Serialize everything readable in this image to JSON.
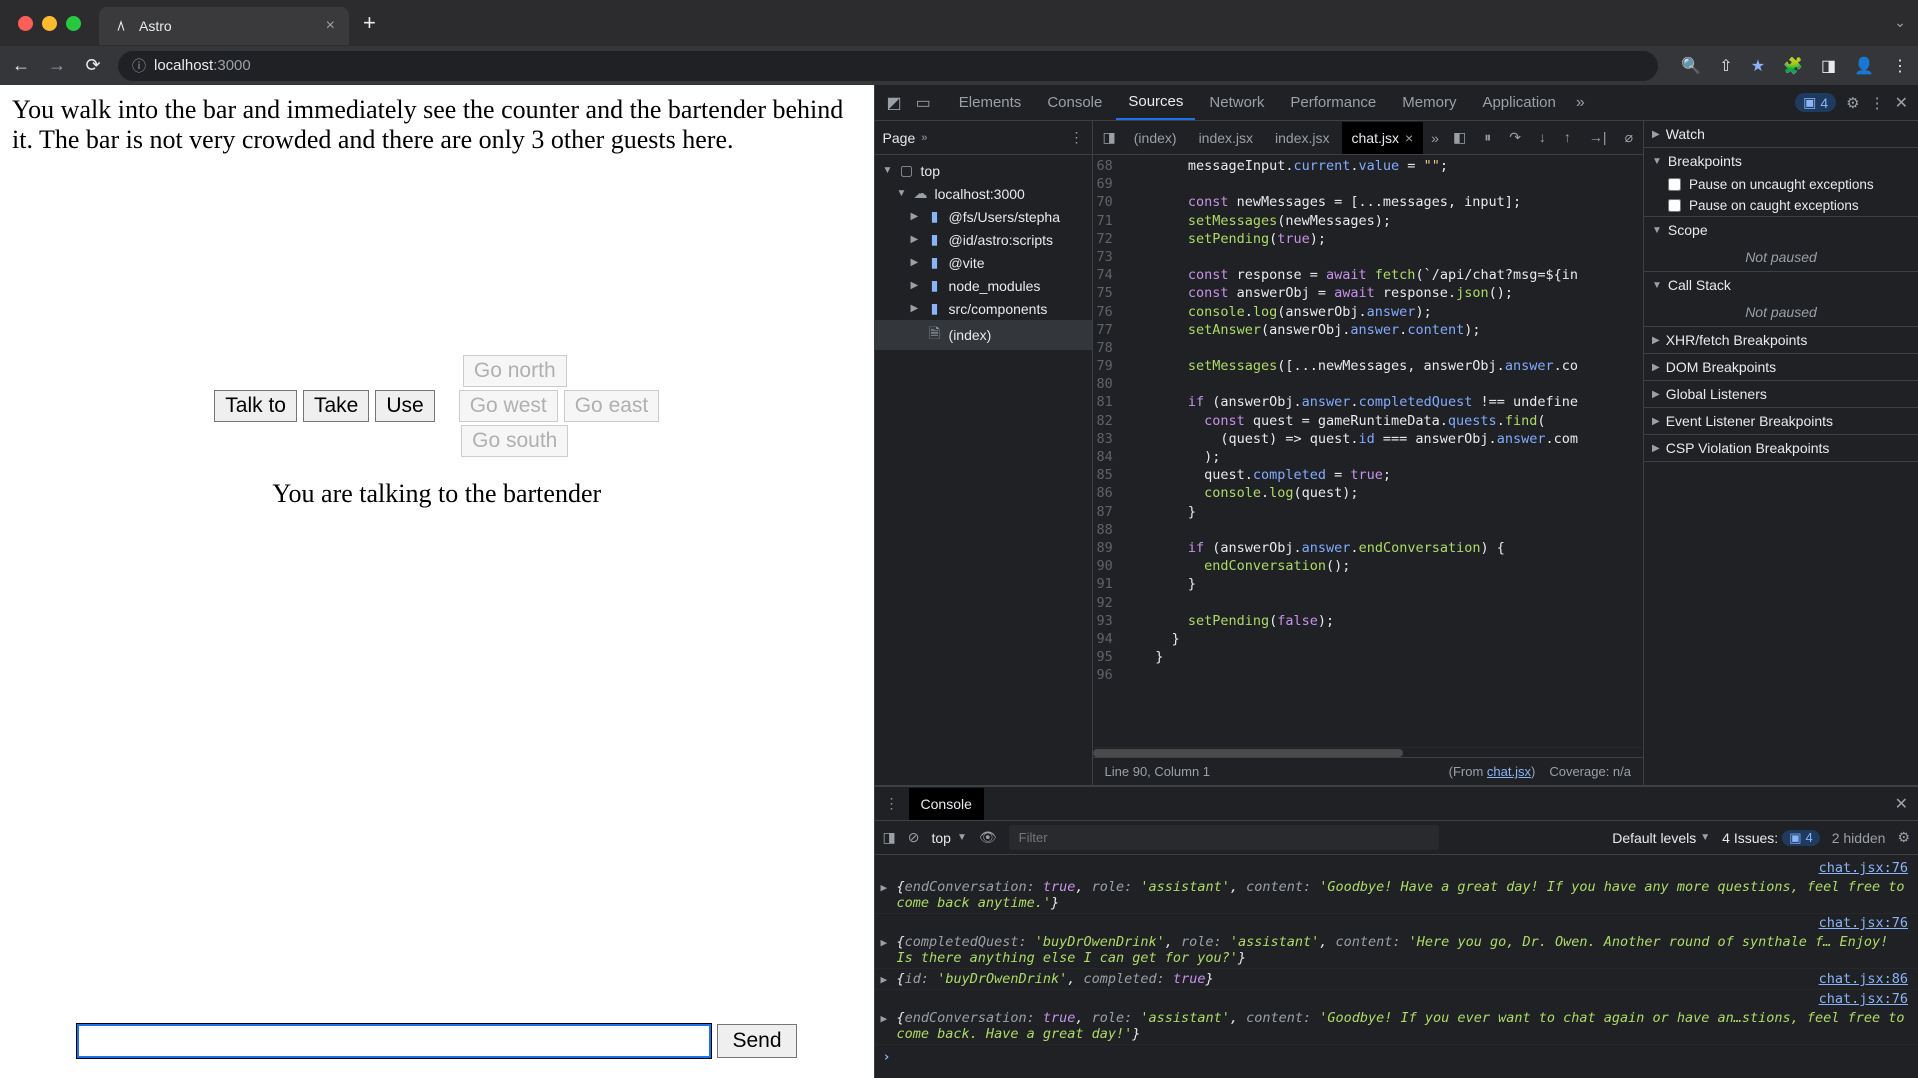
{
  "browser": {
    "tab_title": "Astro",
    "url_host": "localhost",
    "url_port": ":3000"
  },
  "game": {
    "narrative": "You walk into the bar and immediately see the counter and the bartender behind it. The bar is not very crowded and there are only 3 other guests here.",
    "buttons": {
      "talk_to": "Talk to",
      "take": "Take",
      "use": "Use",
      "go_north": "Go north",
      "go_west": "Go west",
      "go_east": "Go east",
      "go_south": "Go south"
    },
    "status": "You are talking to the bartender",
    "send": "Send"
  },
  "devtools": {
    "tabs": {
      "elements": "Elements",
      "console": "Console",
      "sources": "Sources",
      "network": "Network",
      "performance": "Performance",
      "memory": "Memory",
      "application": "Application"
    },
    "error_count": "4",
    "page_label": "Page",
    "tree": {
      "top": "top",
      "host": "localhost:3000",
      "fs": "@fs/Users/stepha",
      "id": "@id/astro:scripts",
      "vite": "@vite",
      "node_modules": "node_modules",
      "src_components": "src/components",
      "index": "(index)"
    },
    "file_tabs": {
      "index_paren": "(index)",
      "index_jsx1": "index.jsx",
      "index_jsx2": "index.jsx",
      "chat_jsx": "chat.jsx"
    },
    "code": {
      "l68": "        messageInput.current.value = \"\";",
      "l69": "",
      "l70": "        const newMessages = [...messages, input];",
      "l71": "        setMessages(newMessages);",
      "l72": "        setPending(true);",
      "l73": "",
      "l74": "        const response = await fetch(`/api/chat?msg=${in",
      "l75": "        const answerObj = await response.json();",
      "l76": "        console.log(answerObj.answer);",
      "l77": "        setAnswer(answerObj.answer.content);",
      "l78": "",
      "l79": "        setMessages([...newMessages, answerObj.answer.co",
      "l80": "",
      "l81": "        if (answerObj.answer.completedQuest !== undefine",
      "l82": "          const quest = gameRuntimeData.quests.find(",
      "l83": "            (quest) => quest.id === answerObj.answer.com",
      "l84": "          );",
      "l85": "          quest.completed = true;",
      "l86": "          console.log(quest);",
      "l87": "        }",
      "l88": "",
      "l89": "        if (answerObj.answer.endConversation) {",
      "l90": "          endConversation();",
      "l91": "        }",
      "l92": "",
      "l93": "        setPending(false);",
      "l94": "      }",
      "l95": "    }",
      "l96": ""
    },
    "line_numbers": [
      "68",
      "69",
      "70",
      "71",
      "72",
      "73",
      "74",
      "75",
      "76",
      "77",
      "78",
      "79",
      "80",
      "81",
      "82",
      "83",
      "84",
      "85",
      "86",
      "87",
      "88",
      "89",
      "90",
      "91",
      "92",
      "93",
      "94",
      "95",
      "96"
    ],
    "status_line": "Line 90, Column 1",
    "status_from_pre": "(From ",
    "status_from_link": "chat.jsx",
    "status_from_post": ")",
    "status_coverage": "Coverage: n/a",
    "debugger": {
      "watch": "Watch",
      "breakpoints": "Breakpoints",
      "pause_uncaught": "Pause on uncaught exceptions",
      "pause_caught": "Pause on caught exceptions",
      "scope": "Scope",
      "not_paused": "Not paused",
      "call_stack": "Call Stack",
      "xhr": "XHR/fetch Breakpoints",
      "dom": "DOM Breakpoints",
      "global": "Global Listeners",
      "event": "Event Listener Breakpoints",
      "csp": "CSP Violation Breakpoints"
    }
  },
  "console_drawer": {
    "tab": "Console",
    "context": "top",
    "filter_placeholder": "Filter",
    "default_levels": "Default levels",
    "issues_label": "4 Issues:",
    "issues_count": "4",
    "hidden": "2 hidden",
    "src76": "chat.jsx:76",
    "src86": "chat.jsx:86",
    "logs": {
      "l1": "{endConversation: true, role: 'assistant', content: 'Goodbye! Have a great day! If you have any more questions, feel free to come back anytime.'}",
      "l2": "{completedQuest: 'buyDrOwenDrink', role: 'assistant', content: 'Here you go, Dr. Owen. Another round of synthale f… Enjoy! Is there anything else I can get for you?'}",
      "l3": "{id: 'buyDrOwenDrink', completed: true}",
      "l4": "{endConversation: true, role: 'assistant', content: 'Goodbye! If you ever want to chat again or have an…stions, feel free to come back. Have a great day!'}"
    }
  }
}
